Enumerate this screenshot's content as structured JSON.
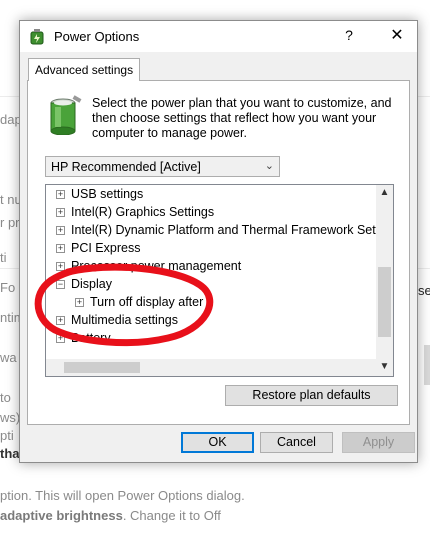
{
  "background": {
    "fragments": {
      "adap": "dap",
      "t_nu": "t nu",
      "r_pro": "r pro",
      "ti": "ti",
      "fo": "Fo",
      "ntim": "ntim",
      "wa": "wa",
      "se_right": "se",
      "line_to": "to",
      "ws": "ws)",
      "pti": "pti",
      "tha": "tha",
      "options_sentence": "ption. This will open Power Options dialog.",
      "adaptive_bold": "adaptive brightness",
      "adaptive_rest": ". Change it to Off"
    }
  },
  "dialog": {
    "title": "Power Options",
    "help_glyph": "?",
    "close_glyph": "✕",
    "tab_label": "Advanced settings",
    "description": "Select the power plan that you want to customize, and then choose settings that reflect how you want your computer to manage power.",
    "plan_selected": "HP Recommended [Active]",
    "tree_items": [
      {
        "label": "USB settings",
        "state": "collapsed",
        "level": 0
      },
      {
        "label": "Intel(R) Graphics Settings",
        "state": "collapsed",
        "level": 0
      },
      {
        "label": "Intel(R) Dynamic Platform and Thermal Framework Settings",
        "state": "collapsed",
        "level": 0
      },
      {
        "label": "PCI Express",
        "state": "collapsed",
        "level": 0
      },
      {
        "label": "Processor power management",
        "state": "collapsed",
        "level": 0
      },
      {
        "label": "Display",
        "state": "expanded",
        "level": 0
      },
      {
        "label": "Turn off display after",
        "state": "collapsed",
        "level": 1
      },
      {
        "label": "Multimedia settings",
        "state": "collapsed",
        "level": 0
      },
      {
        "label": "Battery",
        "state": "collapsed",
        "level": 0
      }
    ],
    "restore_label": "Restore plan defaults",
    "ok_label": "OK",
    "cancel_label": "Cancel",
    "apply_label": "Apply"
  },
  "colors": {
    "annotation": "#e8101a",
    "dialog_bg": "#f0f0f0",
    "default_button_border": "#0078d7"
  }
}
